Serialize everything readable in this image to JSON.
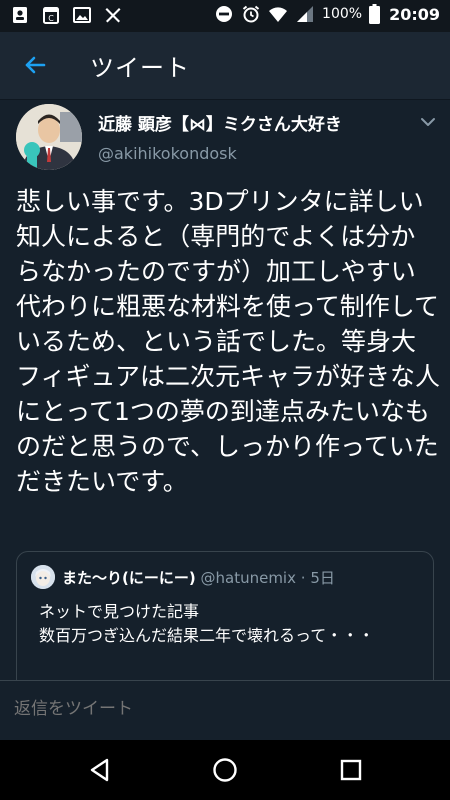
{
  "status_bar": {
    "icons_left": [
      "contact-card-icon",
      "calendar-icon",
      "image-icon",
      "tools-icon"
    ],
    "icons_right": [
      "do-not-disturb-icon",
      "alarm-icon",
      "wifi-icon",
      "signal-icon"
    ],
    "battery": "100%",
    "time": "20:09"
  },
  "header": {
    "title": "ツイート",
    "back_icon": "arrow-left-icon"
  },
  "tweet": {
    "author_name": "近藤 顕彦【⋈】ミクさん大好き",
    "author_handle": "@akihikokondosk",
    "text": "悲しい事です。3Dプリンタに詳しい知人によると（専門的でよくは分からなかったのですが）加工しやすい代わりに粗悪な材料を使って制作しているため、という話でした。等身大フィギュアは二次元キャラが好きな人にとって1つの夢の到達点みたいなものだと思うので、しっかり作っていただきたいです。"
  },
  "quoted_tweet": {
    "name": "また〜り(にーにー)",
    "handle": "@hatunemix",
    "separator": "·",
    "time": "5日",
    "text": "ネットで見つけた記事\n数百万つぎ込んだ結果二年で壊れるって・・・"
  },
  "reply": {
    "placeholder": "返信をツイート"
  },
  "colors": {
    "background": "#15202b",
    "header": "#1c2733",
    "accent": "#1da1f2",
    "secondary_text": "#8899a6",
    "border": "#38444d"
  },
  "nav": {
    "back": "back-triangle-icon",
    "home": "home-circle-icon",
    "recents": "recents-square-icon"
  }
}
